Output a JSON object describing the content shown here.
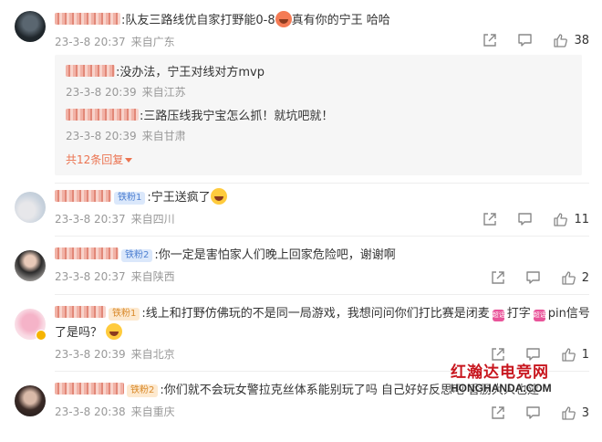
{
  "comments": [
    {
      "text": ":队友三路线优自家打野能0-8",
      "text2": "真有你的宁王 哈哈",
      "date": "23-3-8 20:37",
      "location": "来自广东",
      "likes": "38",
      "replies": [
        {
          "text": ":没办法，宁王对线对方mvp",
          "date": "23-3-8 20:39",
          "location": "来自江苏"
        },
        {
          "text": ":三路压线我宁宝怎么抓！就坑吧就！",
          "date": "23-3-8 20:39",
          "location": "来自甘肃"
        }
      ],
      "more_label": "共12条回复"
    },
    {
      "badge": "铁粉1",
      "text": ":宁王送疯了",
      "date": "23-3-8 20:37",
      "location": "来自四川",
      "likes": "11"
    },
    {
      "badge": "铁粉2",
      "text": ":你一定是害怕家人们晚上回家危险吧，谢谢啊",
      "date": "23-3-8 20:37",
      "location": "来自陕西",
      "likes": "2"
    },
    {
      "badge": "铁粉1",
      "text": ":线上和打野仿佛玩的不是同一局游戏，我想问问你们打比赛是闭麦",
      "text_mid": "打字",
      "text_end": "pin信号",
      "text2": "了是吗？",
      "chip": "超话",
      "date": "23-3-8 20:39",
      "location": "来自北京",
      "likes": "1"
    },
    {
      "badge": "铁粉2",
      "text": ":你们就不会玩女警拉克丝体系能别玩了吗 自己好好反思吧 香肠大人也建",
      "date": "23-3-8 20:38",
      "location": "来自重庆",
      "likes": "3"
    }
  ],
  "watermark": {
    "cn": "红瀚达电竞网",
    "en": "HONGHANDA.COM"
  },
  "icons": {
    "share": "share-icon",
    "comment": "comment-icon",
    "like": "thumbs-up-icon",
    "more": "caret-down-icon"
  },
  "colors": {
    "accent": "#eb7350",
    "meta": "#999999",
    "reply_bg": "#f6f6f6"
  }
}
